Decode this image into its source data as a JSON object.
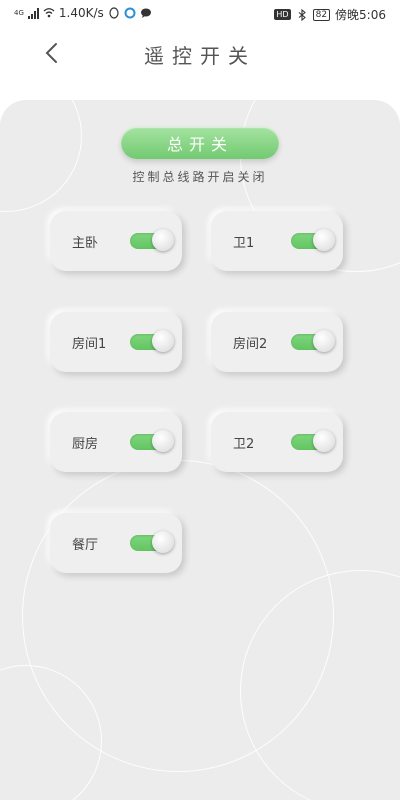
{
  "status_bar": {
    "net_type": "4G",
    "speed": "1.40K/s",
    "hd": "HD",
    "battery": "82",
    "time": "傍晚5:06"
  },
  "header": {
    "title": "遥控开关"
  },
  "master": {
    "label": "总开关",
    "subtitle": "控制总线路开启关闭"
  },
  "switches": [
    {
      "label": "主卧",
      "on": true
    },
    {
      "label": "卫1",
      "on": true
    },
    {
      "label": "房间1",
      "on": true
    },
    {
      "label": "房间2",
      "on": true
    },
    {
      "label": "厨房",
      "on": true
    },
    {
      "label": "卫2",
      "on": true
    },
    {
      "label": "餐厅",
      "on": true
    }
  ],
  "colors": {
    "toggle_on": "#6fcf6e",
    "panel_bg": "#ececec"
  }
}
